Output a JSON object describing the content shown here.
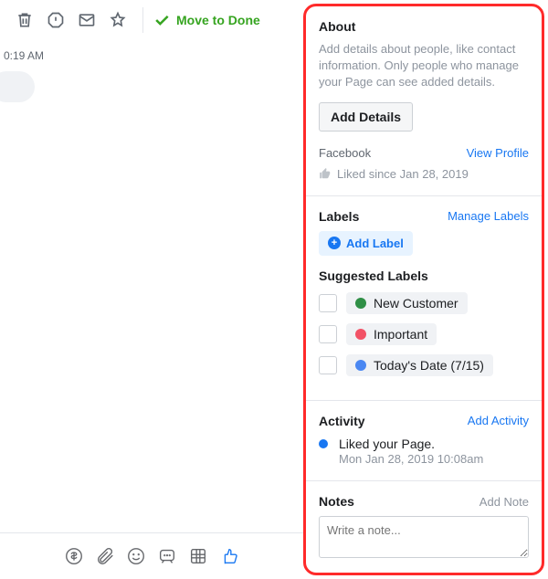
{
  "topbar": {
    "move_to_done": "Move to Done"
  },
  "conversation": {
    "timestamp": "0:19 AM"
  },
  "about": {
    "title": "About",
    "description": "Add details about people, like contact information. Only people who manage your Page can see added details.",
    "add_details_label": "Add Details",
    "source": "Facebook",
    "view_profile": "View Profile",
    "liked_since": "Liked since Jan 28, 2019"
  },
  "labels": {
    "title": "Labels",
    "manage": "Manage Labels",
    "add_label": "Add Label",
    "suggested_heading": "Suggested Labels",
    "suggested": [
      {
        "name": "New Customer",
        "color": "#2f8f46"
      },
      {
        "name": "Important",
        "color": "#f25266"
      },
      {
        "name": "Today's Date (7/15)",
        "color": "#4a87f2"
      }
    ]
  },
  "activity": {
    "title": "Activity",
    "add": "Add Activity",
    "item_text": "Liked your Page.",
    "item_time": "Mon Jan 28, 2019 10:08am"
  },
  "notes": {
    "title": "Notes",
    "add": "Add Note",
    "placeholder": "Write a note..."
  }
}
